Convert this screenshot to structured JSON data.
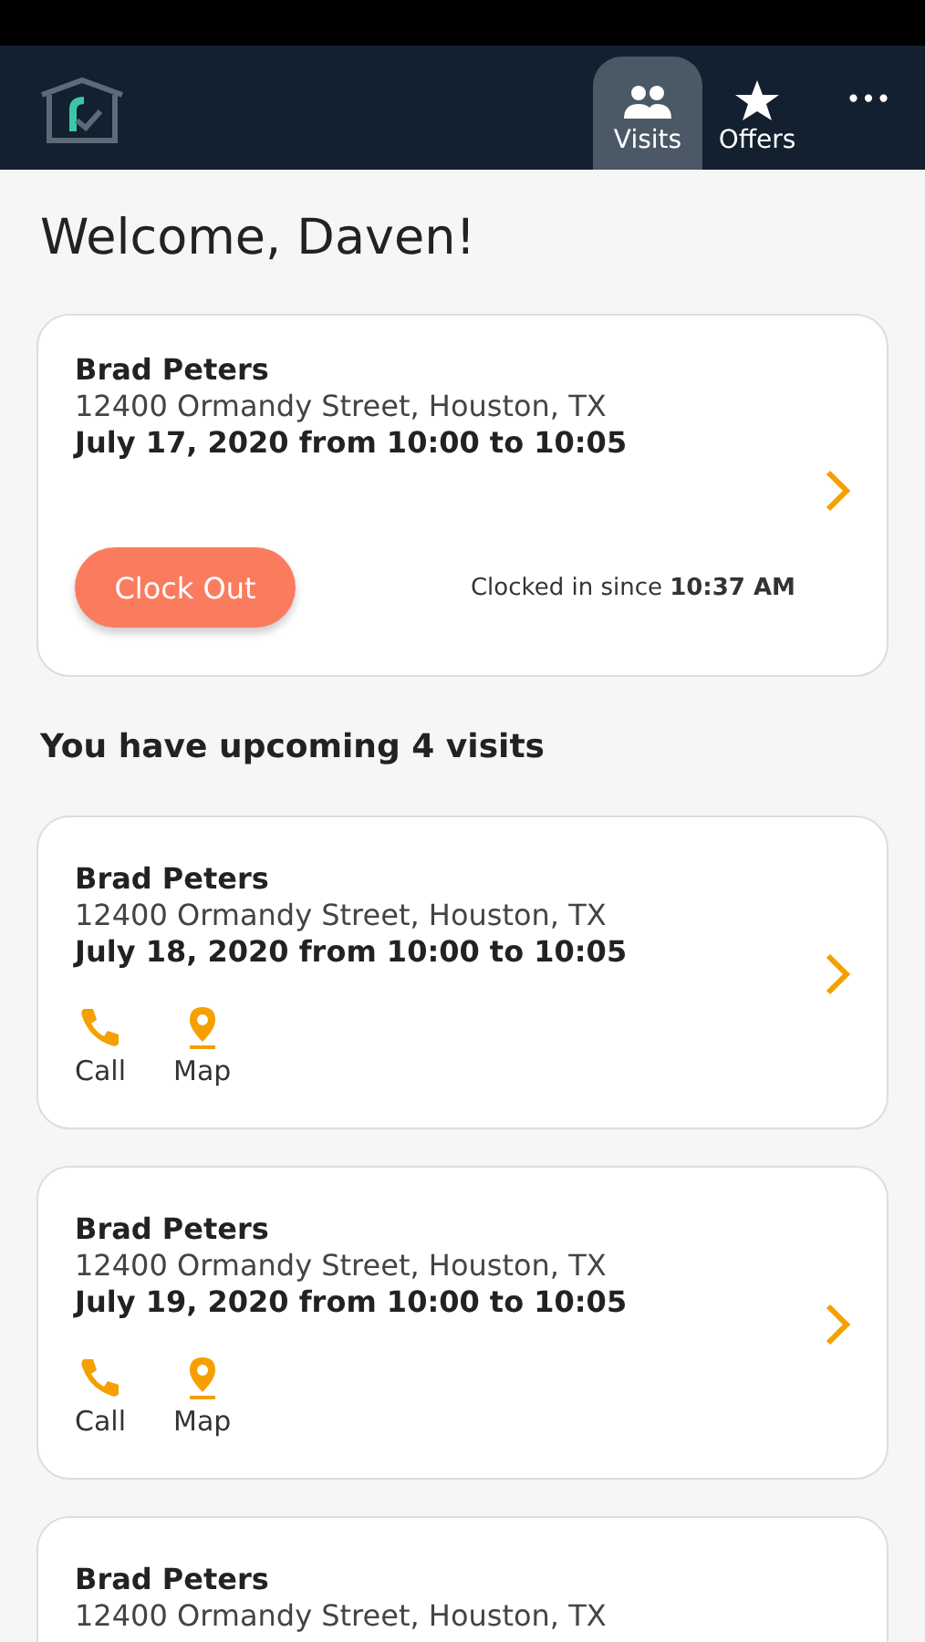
{
  "nav": {
    "tabs": [
      {
        "label": "Visits",
        "kind": "people",
        "selected": true
      },
      {
        "label": "Offers",
        "kind": "star",
        "selected": false
      }
    ],
    "more": "•••"
  },
  "welcome": "Welcome, Daven!",
  "current": {
    "name": "Brad Peters",
    "address": "12400 Ormandy Street, Houston, TX",
    "date": "July 17, 2020 from 10:00 to 10:05",
    "button": "Clock Out",
    "status": "Clocked in since **10:37 AM**"
  },
  "upcoming_title": "You have upcoming 4 visits",
  "visits": [
    {
      "name": "Brad Peters",
      "address": "12400 Ormandy Street, Houston, TX",
      "date": "July 18, 2020 from 10:00 to 10:05",
      "actions": [
        {
          "kind": "call",
          "label": "Call"
        },
        {
          "kind": "map",
          "label": "Map"
        }
      ]
    },
    {
      "name": "Brad Peters",
      "address": "12400 Ormandy Street, Houston, TX",
      "date": "July 19, 2020 from 10:00 to 10:05",
      "actions": [
        {
          "kind": "call",
          "label": "Call"
        },
        {
          "kind": "map",
          "label": "Map"
        }
      ]
    },
    {
      "name": "Brad Peters",
      "address": "12400 Ormandy Street, Houston, TX"
    }
  ]
}
